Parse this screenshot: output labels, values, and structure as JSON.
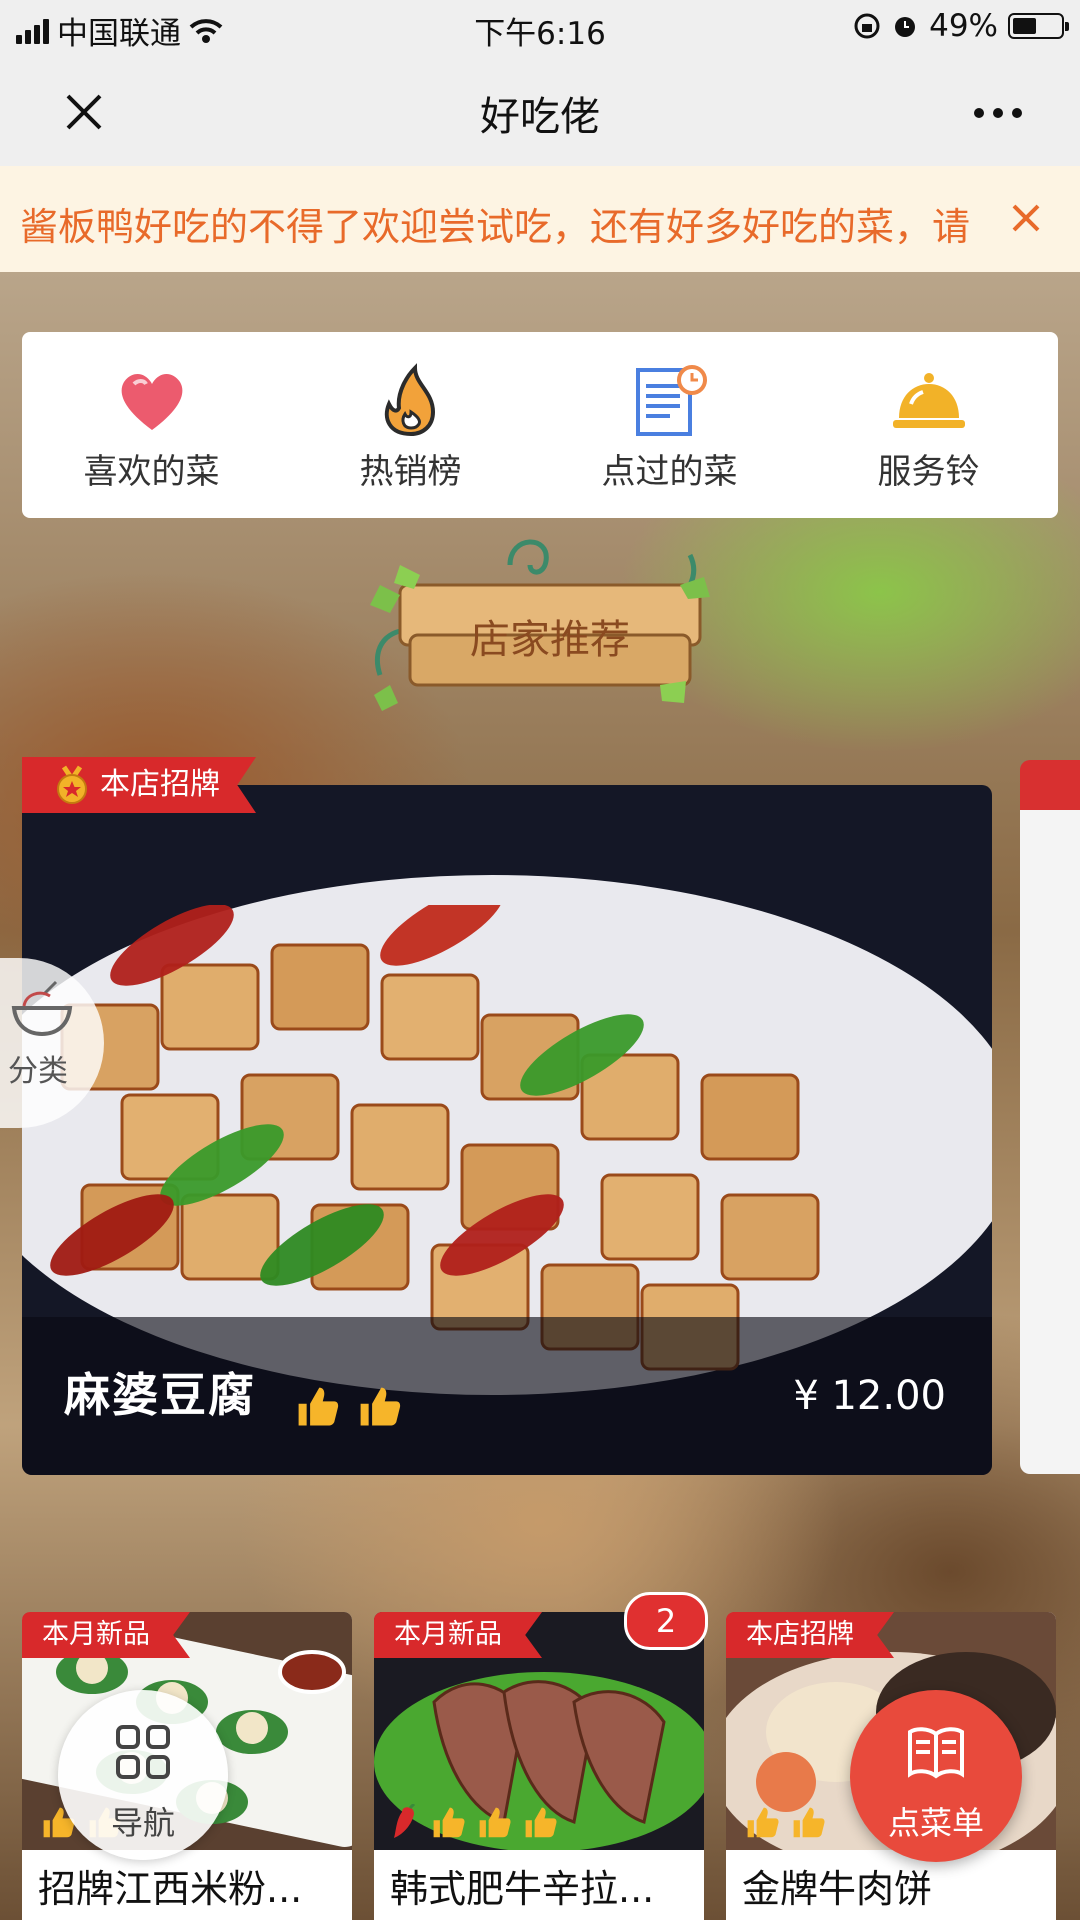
{
  "status_bar": {
    "carrier": "中国联通",
    "time": "下午6:16",
    "battery": "49%",
    "battery_level": 0.49
  },
  "nav": {
    "title": "好吃佬"
  },
  "notice": {
    "text": "酱板鸭好吃的不得了欢迎尝试吃，还有好多好吃的菜，请"
  },
  "quick_menu": [
    {
      "label": "喜欢的菜",
      "icon": "heart-icon"
    },
    {
      "label": "热销榜",
      "icon": "flame-icon"
    },
    {
      "label": "点过的菜",
      "icon": "order-history-icon"
    },
    {
      "label": "服务铃",
      "icon": "service-bell-icon"
    }
  ],
  "section": {
    "title": "店家推荐"
  },
  "featured": {
    "tag": "本店招牌",
    "name": "麻婆豆腐",
    "price": "¥ 12.00",
    "rating_thumbs": 2
  },
  "category_button": {
    "label": "分类"
  },
  "dishes": [
    {
      "tag": "本月新品",
      "name": "招牌江西米粉...",
      "thumbs": 2
    },
    {
      "tag": "本月新品",
      "name": "韩式肥牛辛拉...",
      "thumbs": 3,
      "spicy": true,
      "badge": "2"
    },
    {
      "tag": "本店招牌",
      "name": "金牌牛肉饼",
      "thumbs": 2
    }
  ],
  "floating": {
    "nav_label": "导航",
    "menu_label": "点菜单"
  },
  "colors": {
    "accent_red": "#d8292b",
    "notice_orange": "#e86a2a",
    "menu_button": "#e84a3c"
  }
}
